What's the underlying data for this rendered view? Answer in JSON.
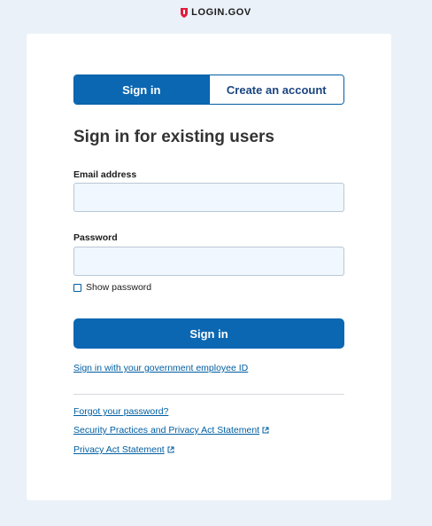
{
  "brand": {
    "name": "LOGIN.GOV",
    "accent": "#e21c3d"
  },
  "colors": {
    "primary": "#0b67b2",
    "link": "#005ea2",
    "background": "#eaf1f9"
  },
  "tabs": [
    {
      "label": "Sign in",
      "active": true
    },
    {
      "label": "Create an account",
      "active": false
    }
  ],
  "heading": "Sign in for existing users",
  "form": {
    "email_label": "Email address",
    "email_value": "",
    "password_label": "Password",
    "password_value": "",
    "show_password_label": "Show password",
    "show_password_checked": false,
    "submit_label": "Sign in"
  },
  "links": {
    "piv": "Sign in with your government employee ID",
    "forgot": "Forgot your password?",
    "security": "Security Practices and Privacy Act Statement",
    "privacy": "Privacy Act Statement"
  },
  "icons": {
    "brand": "shield-icon",
    "external": "external-link-icon"
  }
}
